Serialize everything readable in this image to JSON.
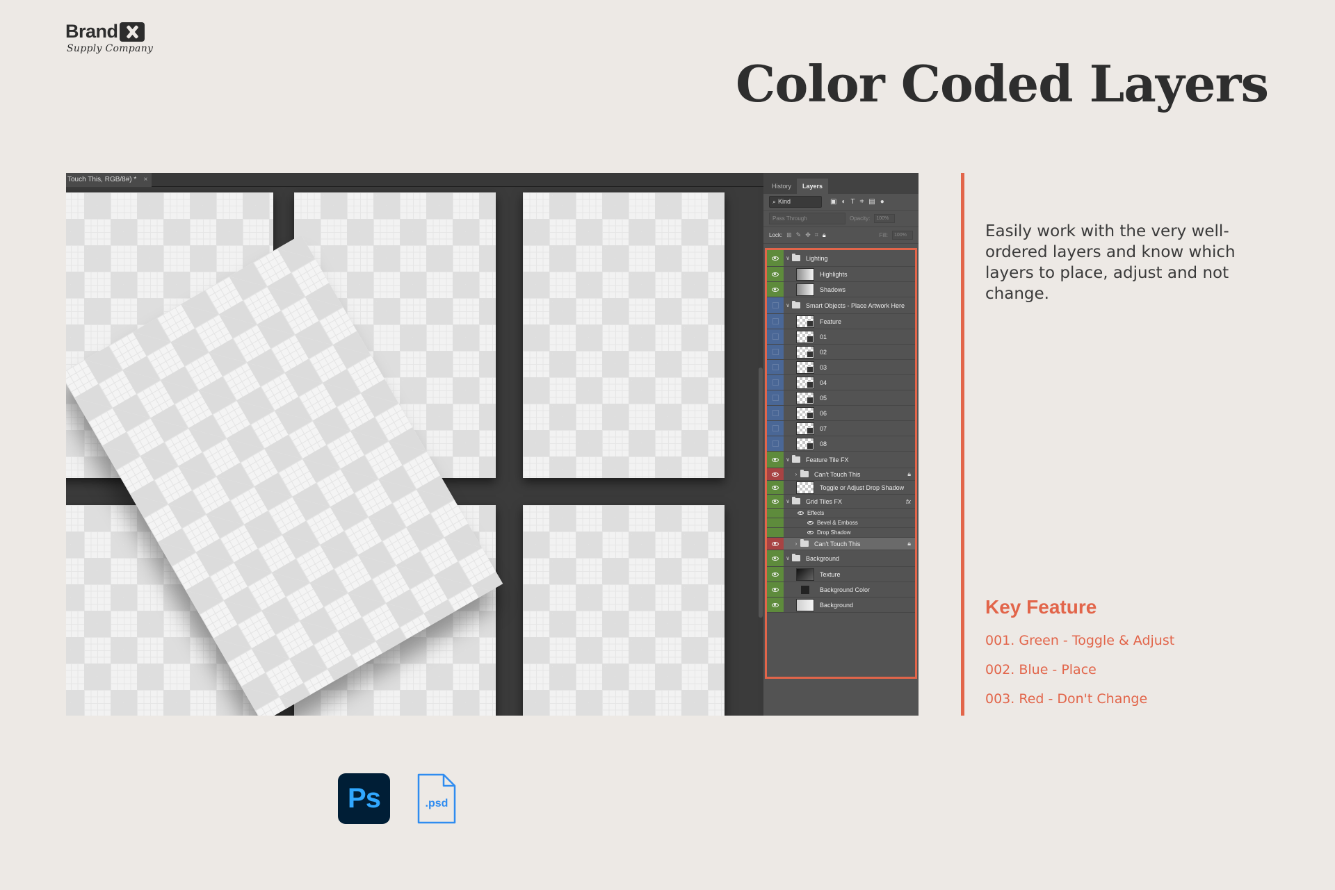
{
  "brand": {
    "name": "Brand",
    "subtitle": "Supply Company"
  },
  "title": "Color Coded Layers",
  "screenshot": {
    "doc_tab": "Touch This, RGB/8#) *",
    "doc_tab_close": "×",
    "panel_tabs": [
      "History",
      "Layers"
    ],
    "filter_kind": "Kind",
    "blend_mode": "Pass Through",
    "opacity_label": "Opacity:",
    "opacity_value": "100%",
    "lock_label": "Lock:",
    "fill_label": "Fill:",
    "fill_value": "100%",
    "layers": [
      {
        "name": "Lighting",
        "color": "green",
        "type": "folder",
        "visible": true
      },
      {
        "name": "Highlights",
        "color": "green",
        "type": "grad",
        "visible": true
      },
      {
        "name": "Shadows",
        "color": "green",
        "type": "grad",
        "visible": true
      },
      {
        "name": "Smart Objects - Place Artwork Here",
        "color": "blue",
        "type": "folder",
        "visible": false
      },
      {
        "name": "Feature",
        "color": "blue",
        "type": "so",
        "visible": false
      },
      {
        "name": "01",
        "color": "blue",
        "type": "so",
        "visible": false
      },
      {
        "name": "02",
        "color": "blue",
        "type": "so",
        "visible": false
      },
      {
        "name": "03",
        "color": "blue",
        "type": "so",
        "visible": false
      },
      {
        "name": "04",
        "color": "blue",
        "type": "so",
        "visible": false
      },
      {
        "name": "05",
        "color": "blue",
        "type": "so",
        "visible": false
      },
      {
        "name": "06",
        "color": "blue",
        "type": "so",
        "visible": false
      },
      {
        "name": "07",
        "color": "blue",
        "type": "so",
        "visible": false
      },
      {
        "name": "08",
        "color": "blue",
        "type": "so",
        "visible": false
      },
      {
        "name": "Feature Tile FX",
        "color": "green",
        "type": "folder",
        "visible": true
      },
      {
        "name": "Can't Touch This",
        "color": "red",
        "type": "subfolder-locked",
        "visible": true
      },
      {
        "name": "Toggle or Adjust Drop Shadow",
        "color": "green",
        "type": "checker",
        "visible": true
      },
      {
        "name": "Grid Tiles FX",
        "color": "green",
        "type": "folder-fx",
        "visible": true
      },
      {
        "name": "Effects",
        "color": "green",
        "type": "effect-head",
        "visible": true
      },
      {
        "name": "Bevel & Emboss",
        "color": "green",
        "type": "effect",
        "visible": true
      },
      {
        "name": "Drop Shadow",
        "color": "green",
        "type": "effect",
        "visible": true
      },
      {
        "name": "Can't Touch This",
        "color": "red",
        "type": "subfolder-locked",
        "visible": true,
        "selected": true
      },
      {
        "name": "Background",
        "color": "green",
        "type": "folder",
        "visible": true
      },
      {
        "name": "Texture",
        "color": "green",
        "type": "texture",
        "visible": true
      },
      {
        "name": "Background Color",
        "color": "green",
        "type": "solid",
        "visible": true
      },
      {
        "name": "Background",
        "color": "green",
        "type": "light",
        "visible": true
      }
    ]
  },
  "description": "Easily work with the very well-ordered layers and know which layers to place, adjust and not change.",
  "key_feature": {
    "title": "Key Feature",
    "items": [
      "001. Green - Toggle & Adjust",
      "002. Blue - Place",
      "003. Red - Don't Change"
    ]
  },
  "icons": {
    "ps": "Ps",
    "psd": ".psd"
  },
  "colors": {
    "accent": "#e2654a",
    "green": "#5e8b3c",
    "blue": "#4a6796",
    "red": "#a84343",
    "background": "#ede9e5"
  }
}
